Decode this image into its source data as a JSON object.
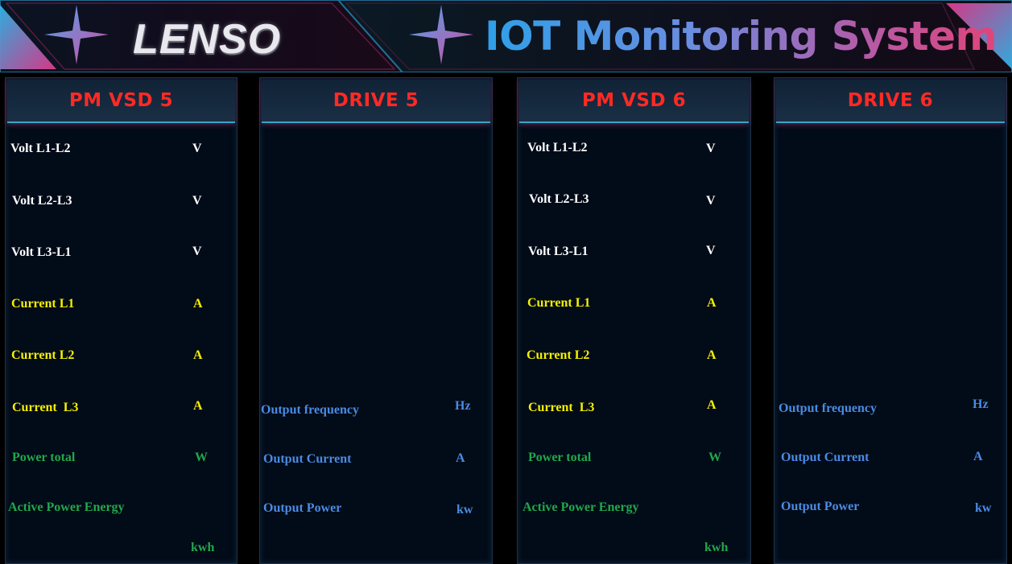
{
  "header": {
    "logo": "LENSO",
    "title": "IOT Monitoring System"
  },
  "panels": {
    "pm_vsd_5": {
      "title": "PM VSD 5",
      "rows": [
        {
          "label": "Volt L1-L2",
          "unit": "V"
        },
        {
          "label": "Volt L2-L3",
          "unit": "V"
        },
        {
          "label": "Volt L3-L1",
          "unit": "V"
        },
        {
          "label": "Current L1",
          "unit": "A"
        },
        {
          "label": "Current L2",
          "unit": "A"
        },
        {
          "label": "Current  L3",
          "unit": "A"
        },
        {
          "label": "Power total",
          "unit": "W"
        },
        {
          "label": "Active Power Energy",
          "unit": "kwh"
        }
      ]
    },
    "drive_5": {
      "title": "DRIVE 5",
      "rows": [
        {
          "label": "Output frequency",
          "unit": "Hz"
        },
        {
          "label": "Output Current",
          "unit": "A"
        },
        {
          "label": "Output Power",
          "unit": "kw"
        }
      ]
    },
    "pm_vsd_6": {
      "title": "PM VSD 6",
      "rows": [
        {
          "label": "Volt L1-L2",
          "unit": "V"
        },
        {
          "label": "Volt L2-L3",
          "unit": "V"
        },
        {
          "label": "Volt L3-L1",
          "unit": "V"
        },
        {
          "label": "Current L1",
          "unit": "A"
        },
        {
          "label": "Current L2",
          "unit": "A"
        },
        {
          "label": "Current  L3",
          "unit": "A"
        },
        {
          "label": "Power total",
          "unit": "W"
        },
        {
          "label": "Active Power Energy",
          "unit": "kwh"
        }
      ]
    },
    "drive_6": {
      "title": "DRIVE 6",
      "rows": [
        {
          "label": "Output frequency",
          "unit": "Hz"
        },
        {
          "label": "Output Current",
          "unit": "A"
        },
        {
          "label": "Output Power",
          "unit": "kw"
        }
      ]
    }
  },
  "colors": {
    "title_red": "#ff2a24",
    "voltage_white": "#ffffff",
    "current_yellow": "#f4f000",
    "power_green": "#21a84a",
    "drive_blue": "#4a8be3"
  }
}
